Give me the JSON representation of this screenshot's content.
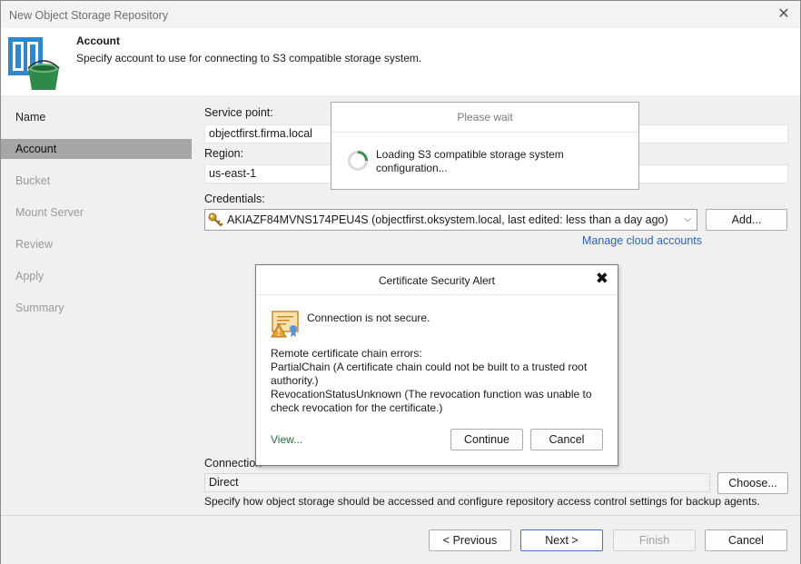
{
  "window": {
    "title": "New Object Storage Repository",
    "close_glyph": "✕"
  },
  "header": {
    "title": "Account",
    "description": "Specify account to use for connecting to S3 compatible storage system.",
    "icon": "object-storage-bucket-icon"
  },
  "sidebar": {
    "items": [
      {
        "label": "Name"
      },
      {
        "label": "Account"
      },
      {
        "label": "Bucket"
      },
      {
        "label": "Mount Server"
      },
      {
        "label": "Review"
      },
      {
        "label": "Apply"
      },
      {
        "label": "Summary"
      }
    ]
  },
  "form": {
    "service_point_label": "Service point:",
    "service_point_value": "objectfirst.firma.local",
    "region_label": "Region:",
    "region_value": "us-east-1",
    "credentials_label": "Credentials:",
    "credentials_value": "AKIAZF84MVNS174PEU4S (objectfirst.oksystem.local, last edited: less than a day ago)",
    "add_label": "Add...",
    "manage_link": "Manage cloud accounts",
    "connection_label": "Connection",
    "connection_value": "Direct",
    "choose_label": "Choose...",
    "connection_hint": "Specify how object storage should be accessed and configure repository access control settings for backup agents."
  },
  "footer": {
    "previous_label": "< Previous",
    "next_label": "Next >",
    "finish_label": "Finish",
    "cancel_label": "Cancel"
  },
  "wait_dialog": {
    "title": "Please wait",
    "message": "Loading S3 compatible storage system configuration..."
  },
  "alert_dialog": {
    "title": "Certificate Security Alert",
    "close_glyph": "✖",
    "main_message": "Connection is not secure.",
    "errors_heading": "Remote certificate chain errors:",
    "error_1": "PartialChain (A certificate chain could not be built to a trusted root authority.)",
    "error_2": "RevocationStatusUnknown (The revocation function was unable to check revocation for the certificate.)",
    "view_link": "View...",
    "continue_label": "Continue",
    "cancel_label": "Cancel"
  },
  "colors": {
    "accent_blue": "#3b74d8",
    "link_blue": "#2c64b5",
    "link_green": "#2e6c3f",
    "selected_step": "#a6a6a6",
    "spinner_green": "#3c8f54"
  }
}
